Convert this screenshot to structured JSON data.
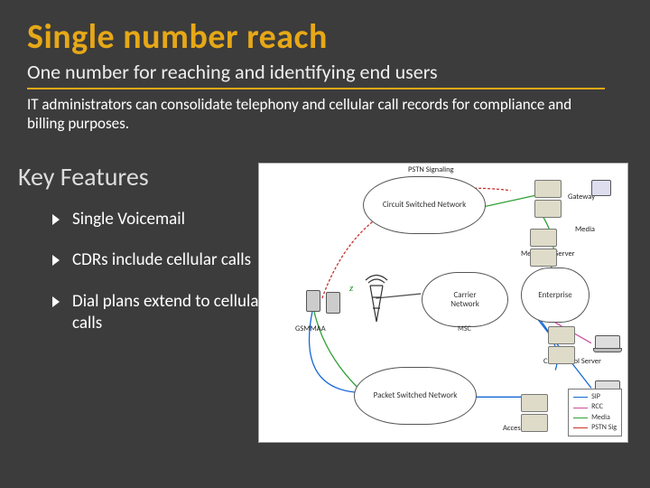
{
  "title": "Single number reach",
  "subtitle": "One number for reaching and identifying end users",
  "intro": "IT administrators can consolidate telephony and cellular call records for compliance and billing purposes.",
  "section": "Key Features",
  "features": [
    "Single Voicemail",
    "CDRs include cellular calls",
    "Dial plans extend to cellular calls"
  ],
  "diagram": {
    "clouds": {
      "csn": "Circuit Switched Network",
      "carrier": "Carrier\nNetwork",
      "enterprise": "Enterprise",
      "psn": "Packet Switched Network"
    },
    "labels": {
      "pstn_sig": "PSTN Signaling",
      "gateway": "Gateway",
      "media": "Media",
      "mediation": "Mediation Server",
      "ccs": "Call Control Server",
      "access_proxy": "Access Proxy",
      "gsm": "GSMMAA",
      "msc": "MSC",
      "z": "z"
    },
    "legend": [
      {
        "name": "SIP",
        "color": "#1466d6"
      },
      {
        "name": "RCC",
        "color": "#c94f9b"
      },
      {
        "name": "Media",
        "color": "#2fa035"
      },
      {
        "name": "PSTN Sig",
        "color": "#c9302c"
      }
    ]
  }
}
